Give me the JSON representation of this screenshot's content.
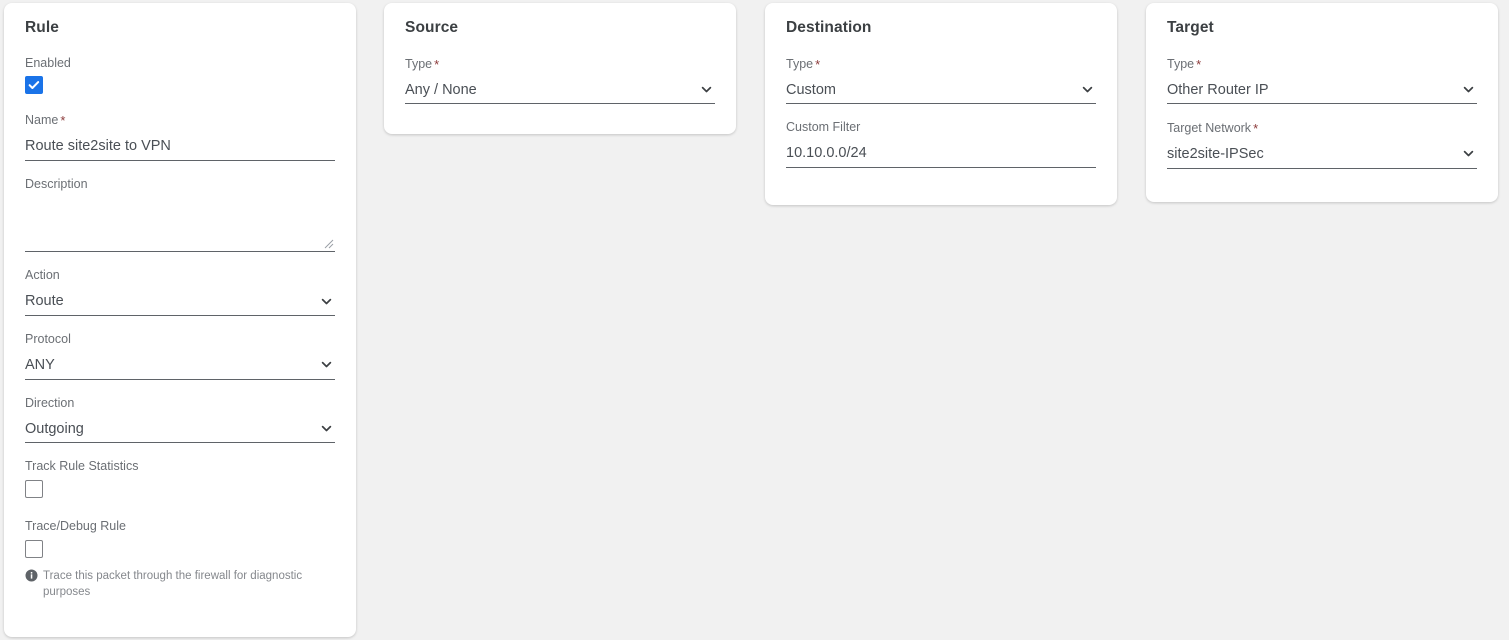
{
  "colors": {
    "page_background": "#f1f1f1",
    "card_background": "#ffffff",
    "accent_checked": "#1a73e8",
    "required_asterisk": "#8c3a3a",
    "label_text": "#6b6f74",
    "value_text": "#4a4f55",
    "underline": "#5f6368",
    "hint_text": "#85888d",
    "info_icon": "#5f6368"
  },
  "panels": {
    "rule": {
      "title": "Rule",
      "enabled": {
        "label": "Enabled",
        "checked": true,
        "icon": "checkbox-checked-icon"
      },
      "name": {
        "label": "Name",
        "required": true,
        "required_marker": "*",
        "value": "Route site2site to VPN",
        "placeholder": ""
      },
      "description": {
        "label": "Description",
        "required": false,
        "value": "",
        "placeholder": "",
        "resize_handle_icon": "resize-grip-icon"
      },
      "action": {
        "label": "Action",
        "required": false,
        "value": "Route",
        "chevron_icon": "chevron-down-icon"
      },
      "protocol": {
        "label": "Protocol",
        "required": false,
        "value": "ANY",
        "chevron_icon": "chevron-down-icon"
      },
      "direction": {
        "label": "Direction",
        "required": false,
        "value": "Outgoing",
        "chevron_icon": "chevron-down-icon"
      },
      "track_rule_statistics": {
        "label": "Track Rule Statistics",
        "checked": false,
        "icon": "checkbox-unchecked-icon"
      },
      "trace_debug_rule": {
        "label": "Trace/Debug Rule",
        "checked": false,
        "icon": "checkbox-unchecked-icon",
        "hint": "Trace this packet through the firewall for diagnostic purposes",
        "hint_icon": "info-icon"
      }
    },
    "source": {
      "title": "Source",
      "type": {
        "label": "Type",
        "required": true,
        "required_marker": "*",
        "value": "Any / None",
        "chevron_icon": "chevron-down-icon"
      }
    },
    "destination": {
      "title": "Destination",
      "type": {
        "label": "Type",
        "required": true,
        "required_marker": "*",
        "value": "Custom",
        "chevron_icon": "chevron-down-icon"
      },
      "custom_filter": {
        "label": "Custom Filter",
        "required": false,
        "value": "10.10.0.0/24",
        "placeholder": ""
      }
    },
    "target": {
      "title": "Target",
      "type": {
        "label": "Type",
        "required": true,
        "required_marker": "*",
        "value": "Other Router IP",
        "chevron_icon": "chevron-down-icon"
      },
      "target_network": {
        "label": "Target Network",
        "required": true,
        "required_marker": "*",
        "value": "site2site-IPSec",
        "chevron_icon": "chevron-down-icon"
      }
    }
  }
}
